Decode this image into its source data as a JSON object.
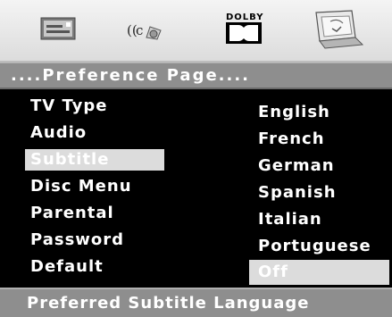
{
  "toolbar": {
    "icons": [
      "tv-setup-icon",
      "audio-speaker-icon",
      "dolby-icon",
      "preference-monitor-icon"
    ],
    "dolby_label": "DOLBY"
  },
  "page_title": "....Preference Page....",
  "menu": {
    "selected": "Subtitle",
    "items": [
      "TV Type",
      "Audio",
      "Subtitle",
      "Disc Menu",
      "Parental",
      "Password",
      "Default"
    ]
  },
  "options": {
    "selected": "Off",
    "items": [
      "English",
      "French",
      "German",
      "Spanish",
      "Italian",
      "Portuguese",
      "Off"
    ]
  },
  "status": "Preferred Subtitle Language",
  "colors": {
    "background": "#000000",
    "bar": "#8e8e8e",
    "highlight": "#dcdcdc",
    "text": "#ffffff"
  }
}
